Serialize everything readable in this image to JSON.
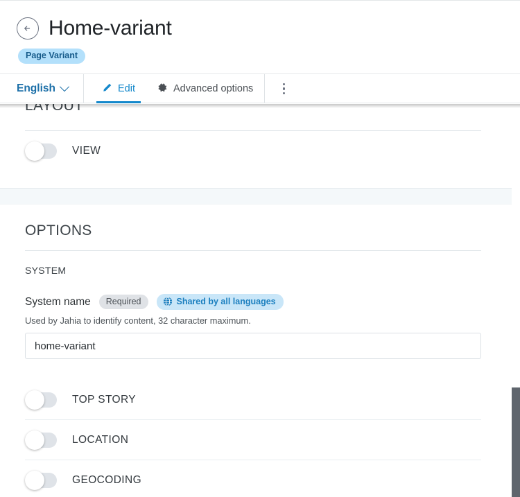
{
  "header": {
    "back_icon": "arrow-left-circle-icon",
    "title": "Home-variant",
    "variant_badge": "Page Variant"
  },
  "toolbar": {
    "language": "English",
    "language_chevron_icon": "chevron-down-icon",
    "tabs": [
      {
        "label": "Edit",
        "icon": "pencil-icon",
        "active": true
      },
      {
        "label": "Advanced options",
        "icon": "gear-icon",
        "active": false
      }
    ],
    "more_icon": "kebab-menu-icon"
  },
  "layout_section": {
    "title": "LAYOUT",
    "toggles": [
      {
        "label": "VIEW",
        "on": false
      }
    ]
  },
  "options_section": {
    "title": "OPTIONS",
    "subsection_title": "SYSTEM",
    "field": {
      "label": "System name",
      "required_badge": "Required",
      "shared_badge": "Shared by all languages",
      "shared_badge_icon": "globe-icon",
      "help_text": "Used by Jahia to identify content, 32 character maximum.",
      "value": "home-variant",
      "placeholder": ""
    },
    "toggles": [
      {
        "label": "TOP STORY",
        "on": false
      },
      {
        "label": "LOCATION",
        "on": false
      },
      {
        "label": "GEOCODING",
        "on": false
      }
    ]
  },
  "colors": {
    "accent_blue": "#1488cb",
    "link_blue": "#1b6fa8",
    "badge_variant_bg": "#b3e0fb",
    "badge_shared_bg": "#c9e6f8",
    "badge_required_bg": "#dfe2e6",
    "scrollbar_thumb": "#5f656d"
  }
}
